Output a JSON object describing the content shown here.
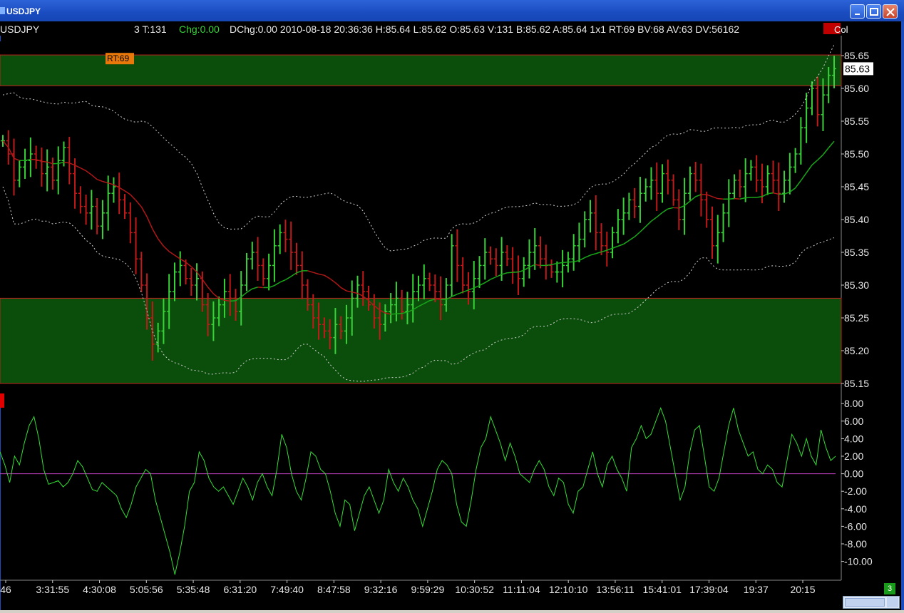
{
  "window": {
    "title": "USDJPY",
    "page_badge": "3"
  },
  "quote_line": {
    "symbol": "USDJPY",
    "trades": "3 T:131",
    "chg_label": "Chg:0.00",
    "rest": "DChg:0.00 2010-08-18 20:36:36 H:85.64 L:85.62 O:85.63 V:131 B:85.62 A:85.64 1x1 RT:69 BV:68 AV:63 DV:56162",
    "corner": "Col"
  },
  "colors": {
    "up": "#39d339",
    "down": "#c11a1a",
    "band_zone": "#0b4d0b",
    "zone_border": "#c02020",
    "bollinger": "#d0d0d0",
    "ma_red": "#b01818",
    "ma_green": "#1aa81a",
    "oscillator": "#33dd33",
    "zero_line": "#c040c0"
  },
  "rt_badge": "RT:69",
  "price_label": "85.63",
  "chart_data": [
    {
      "type": "ohlc",
      "title": "",
      "y_ticks": [
        "85.65",
        "85.60",
        "85.55",
        "85.50",
        "85.45",
        "85.40",
        "85.35",
        "85.30",
        "85.25",
        "85.20",
        "85.15"
      ],
      "ylim": [
        85.15,
        85.66
      ],
      "x_tick_labels": [
        "46",
        "3:31:55",
        "4:30:08",
        "5:05:56",
        "5:35:48",
        "6:31:20",
        "7:49:40",
        "8:47:58",
        "9:32:16",
        "9:59:29",
        "10:30:52",
        "11:11:04",
        "12:10:10",
        "13:56:11",
        "15:41:01",
        "17:39:04",
        "19:37",
        "20:15"
      ],
      "zones": [
        {
          "from": 85.604,
          "to": 85.651
        },
        {
          "from": 85.15,
          "to": 85.28
        }
      ],
      "close_path": [
        85.52,
        85.5,
        85.46,
        85.48,
        85.49,
        85.5,
        85.49,
        85.47,
        85.48,
        85.46,
        85.49,
        85.51,
        85.47,
        85.44,
        85.42,
        85.41,
        85.42,
        85.39,
        85.41,
        85.44,
        85.45,
        85.43,
        85.41,
        85.38,
        85.34,
        85.3,
        85.25,
        85.21,
        85.23,
        85.26,
        85.29,
        85.32,
        85.33,
        85.31,
        85.3,
        85.31,
        85.27,
        85.24,
        85.25,
        85.27,
        85.29,
        85.28,
        85.26,
        85.3,
        85.34,
        85.35,
        85.33,
        85.31,
        85.33,
        85.36,
        85.38,
        85.37,
        85.35,
        85.33,
        85.3,
        85.27,
        85.25,
        85.24,
        85.23,
        85.22,
        85.24,
        85.23,
        85.25,
        85.28,
        85.3,
        85.29,
        85.27,
        85.25,
        85.24,
        85.26,
        85.27,
        85.28,
        85.26,
        85.27,
        85.29,
        85.3,
        85.31,
        85.3,
        85.29,
        85.27,
        85.3,
        85.36,
        85.33,
        85.3,
        85.29,
        85.31,
        85.33,
        85.35,
        85.34,
        85.33,
        85.35,
        85.34,
        85.32,
        85.31,
        85.33,
        85.35,
        85.36,
        85.34,
        85.33,
        85.32,
        85.32,
        85.33,
        85.34,
        85.36,
        85.37,
        85.4,
        85.41,
        85.38,
        85.36,
        85.35,
        85.38,
        85.4,
        85.41,
        85.43,
        85.42,
        85.44,
        85.45,
        85.46,
        85.44,
        85.47,
        85.46,
        85.43,
        85.4,
        85.44,
        85.47,
        85.46,
        85.43,
        85.4,
        85.36,
        85.38,
        85.41,
        85.44,
        85.46,
        85.45,
        85.47,
        85.48,
        85.46,
        85.45,
        85.47,
        85.46,
        85.44,
        85.46,
        85.48,
        85.5,
        85.54,
        85.57,
        85.6,
        85.56,
        85.59,
        85.62,
        85.63
      ],
      "series": [
        {
          "name": "",
          "kind": "bollinger_upper"
        },
        {
          "name": "",
          "kind": "bollinger_lower"
        },
        {
          "name": "",
          "kind": "moving_average"
        }
      ]
    },
    {
      "type": "line",
      "title": "",
      "y_ticks": [
        "8.00",
        "6.00",
        "4.00",
        "2.00",
        "0.00",
        "-2.00",
        "-4.00",
        "-6.00",
        "-8.00",
        "-10.00"
      ],
      "ylim": [
        -11,
        8.5
      ],
      "values": [
        2.5,
        1.0,
        -1.0,
        2.0,
        1.0,
        3.5,
        5.5,
        6.5,
        4.0,
        0.5,
        -1.2,
        -1.0,
        -0.8,
        -1.5,
        -1.0,
        0.0,
        1.5,
        0.8,
        -0.5,
        -1.8,
        -2.0,
        -1.0,
        -1.5,
        -2.0,
        -2.5,
        -4.0,
        -5.0,
        -3.5,
        -1.5,
        -0.5,
        0.5,
        0.0,
        -3.0,
        -5.0,
        -7.0,
        -9.0,
        -11.5,
        -9.0,
        -6.0,
        -2.0,
        -1.0,
        2.5,
        1.5,
        -0.5,
        -1.5,
        -2.0,
        -1.5,
        -2.5,
        -3.5,
        -2.0,
        -0.5,
        -1.5,
        -3.0,
        -1.0,
        0.0,
        -1.5,
        -2.5,
        0.5,
        4.5,
        3.0,
        0.0,
        -2.0,
        -3.0,
        -0.5,
        2.5,
        2.0,
        0.5,
        0.0,
        -2.0,
        -4.5,
        -6.0,
        -3.0,
        -3.5,
        -6.5,
        -4.5,
        -2.5,
        -1.5,
        -3.0,
        -4.5,
        -3.0,
        0.5,
        -1.0,
        -2.0,
        -0.5,
        -1.5,
        -3.0,
        -4.0,
        -6.0,
        -4.0,
        -2.0,
        0.5,
        1.5,
        1.0,
        0.0,
        -3.5,
        -5.5,
        -6.0,
        -3.0,
        0.5,
        3.0,
        4.0,
        6.5,
        5.0,
        3.5,
        1.5,
        3.5,
        2.0,
        0.0,
        -0.5,
        -1.0,
        0.5,
        1.5,
        0.5,
        -1.5,
        -2.5,
        -0.5,
        -1.0,
        -3.5,
        -4.5,
        -2.0,
        -1.5,
        0.5,
        2.5,
        0.0,
        -1.5,
        1.0,
        2.0,
        0.5,
        -0.5,
        -2.0,
        3.0,
        4.0,
        5.5,
        4.0,
        4.5,
        6.0,
        7.5,
        6.0,
        3.0,
        0.0,
        -3.0,
        -1.5,
        2.5,
        5.0,
        5.5,
        2.0,
        -1.5,
        -2.0,
        -0.5,
        2.5,
        5.5,
        7.5,
        5.0,
        3.5,
        2.0,
        2.5,
        0.5,
        0.0,
        1.0,
        0.5,
        -1.0,
        -1.5,
        1.5,
        4.5,
        3.5,
        2.0,
        4.0,
        2.0,
        1.0,
        5.0,
        3.0,
        1.5,
        2.0
      ],
      "reference_line": 0.0
    }
  ]
}
